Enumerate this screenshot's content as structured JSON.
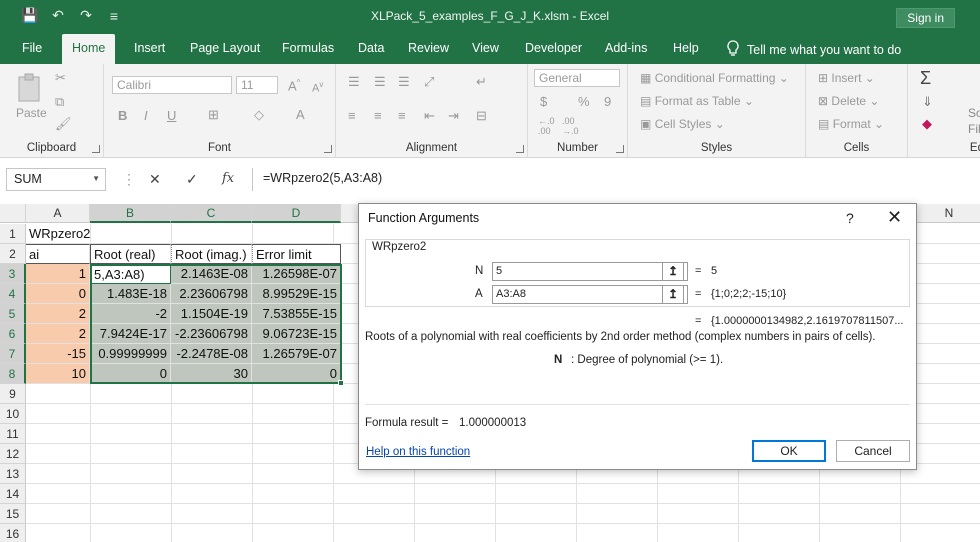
{
  "titlebar": {
    "title": "XLPack_5_examples_F_G_J_K.xlsm  -  Excel",
    "signin": "Sign in",
    "qat": {
      "save": "💾",
      "undo": "↶",
      "redo": "↷",
      "customize": "≡"
    }
  },
  "tabs": {
    "items": [
      "File",
      "Home",
      "Insert",
      "Page Layout",
      "Formulas",
      "Data",
      "Review",
      "View",
      "Developer",
      "Add-ins",
      "Help"
    ],
    "active": "Home",
    "tell_me": "Tell me what you want to do"
  },
  "ribbon": {
    "clipboard": {
      "label": "Clipboard",
      "paste": "Paste"
    },
    "font": {
      "label": "Font",
      "name": "Calibri",
      "size": "11",
      "bold": "B",
      "italic": "I",
      "underline": "U"
    },
    "alignment": {
      "label": "Alignment"
    },
    "number": {
      "label": "Number",
      "format": "General",
      "currency": "$",
      "percent": "%",
      "comma": "9"
    },
    "styles": {
      "label": "Styles",
      "conditional": "Conditional Formatting",
      "table": "Format as Table",
      "cell_styles": "Cell Styles"
    },
    "cells": {
      "label": "Cells",
      "insert": "Insert",
      "delete": "Delete",
      "format": "Format"
    },
    "editing": {
      "label": "Ed",
      "sort": "So",
      "find": "Filt"
    }
  },
  "formula_bar": {
    "name_box": "SUM",
    "cancel": "✕",
    "enter": "✓",
    "fx": "fx",
    "formula": "=WRpzero2(5,A3:A8)"
  },
  "grid": {
    "columns": [
      "A",
      "B",
      "C",
      "D",
      "N"
    ],
    "rows": [
      "1",
      "2",
      "3",
      "4",
      "5",
      "6",
      "7",
      "8",
      "9",
      "10",
      "11",
      "12",
      "13",
      "14",
      "15",
      "16"
    ],
    "a1": "WRpzero2",
    "headers": [
      "ai",
      "Root (real)",
      "Root (imag.)",
      "Error limit"
    ],
    "data": [
      [
        "1",
        "5,A3:A8)",
        "2.1463E-08",
        "1.26598E-07"
      ],
      [
        "0",
        "1.483E-18",
        "2.23606798",
        "8.99529E-15"
      ],
      [
        "2",
        "-2",
        "1.1504E-19",
        "7.53855E-15"
      ],
      [
        "2",
        "7.9424E-17",
        "-2.23606798",
        "9.06723E-15"
      ],
      [
        "-15",
        "0.99999999",
        "-2.2478E-08",
        "1.26579E-07"
      ],
      [
        "10",
        "0",
        "30",
        "0"
      ]
    ]
  },
  "dialog": {
    "title": "Function Arguments",
    "help_glyph": "?",
    "close_glyph": "✕",
    "function_name": "WRpzero2",
    "args": [
      {
        "label": "N",
        "value": "5",
        "result": "5"
      },
      {
        "label": "A",
        "value": "A3:A8",
        "result": "{1;0;2;2;-15;10}"
      }
    ],
    "equals": "=",
    "overall_result": "{1.0000000134982,2.1619707811507...",
    "description": "Roots of a polynomial with real coefficients by 2nd order method (complex numbers in pairs of cells).",
    "arg_help_label": "N",
    "arg_help_text": ": Degree of polynomial (>= 1).",
    "formula_result_label": "Formula result =",
    "formula_result_value": "1.000000013",
    "help_link": "Help on this function",
    "ok": "OK",
    "cancel": "Cancel"
  }
}
